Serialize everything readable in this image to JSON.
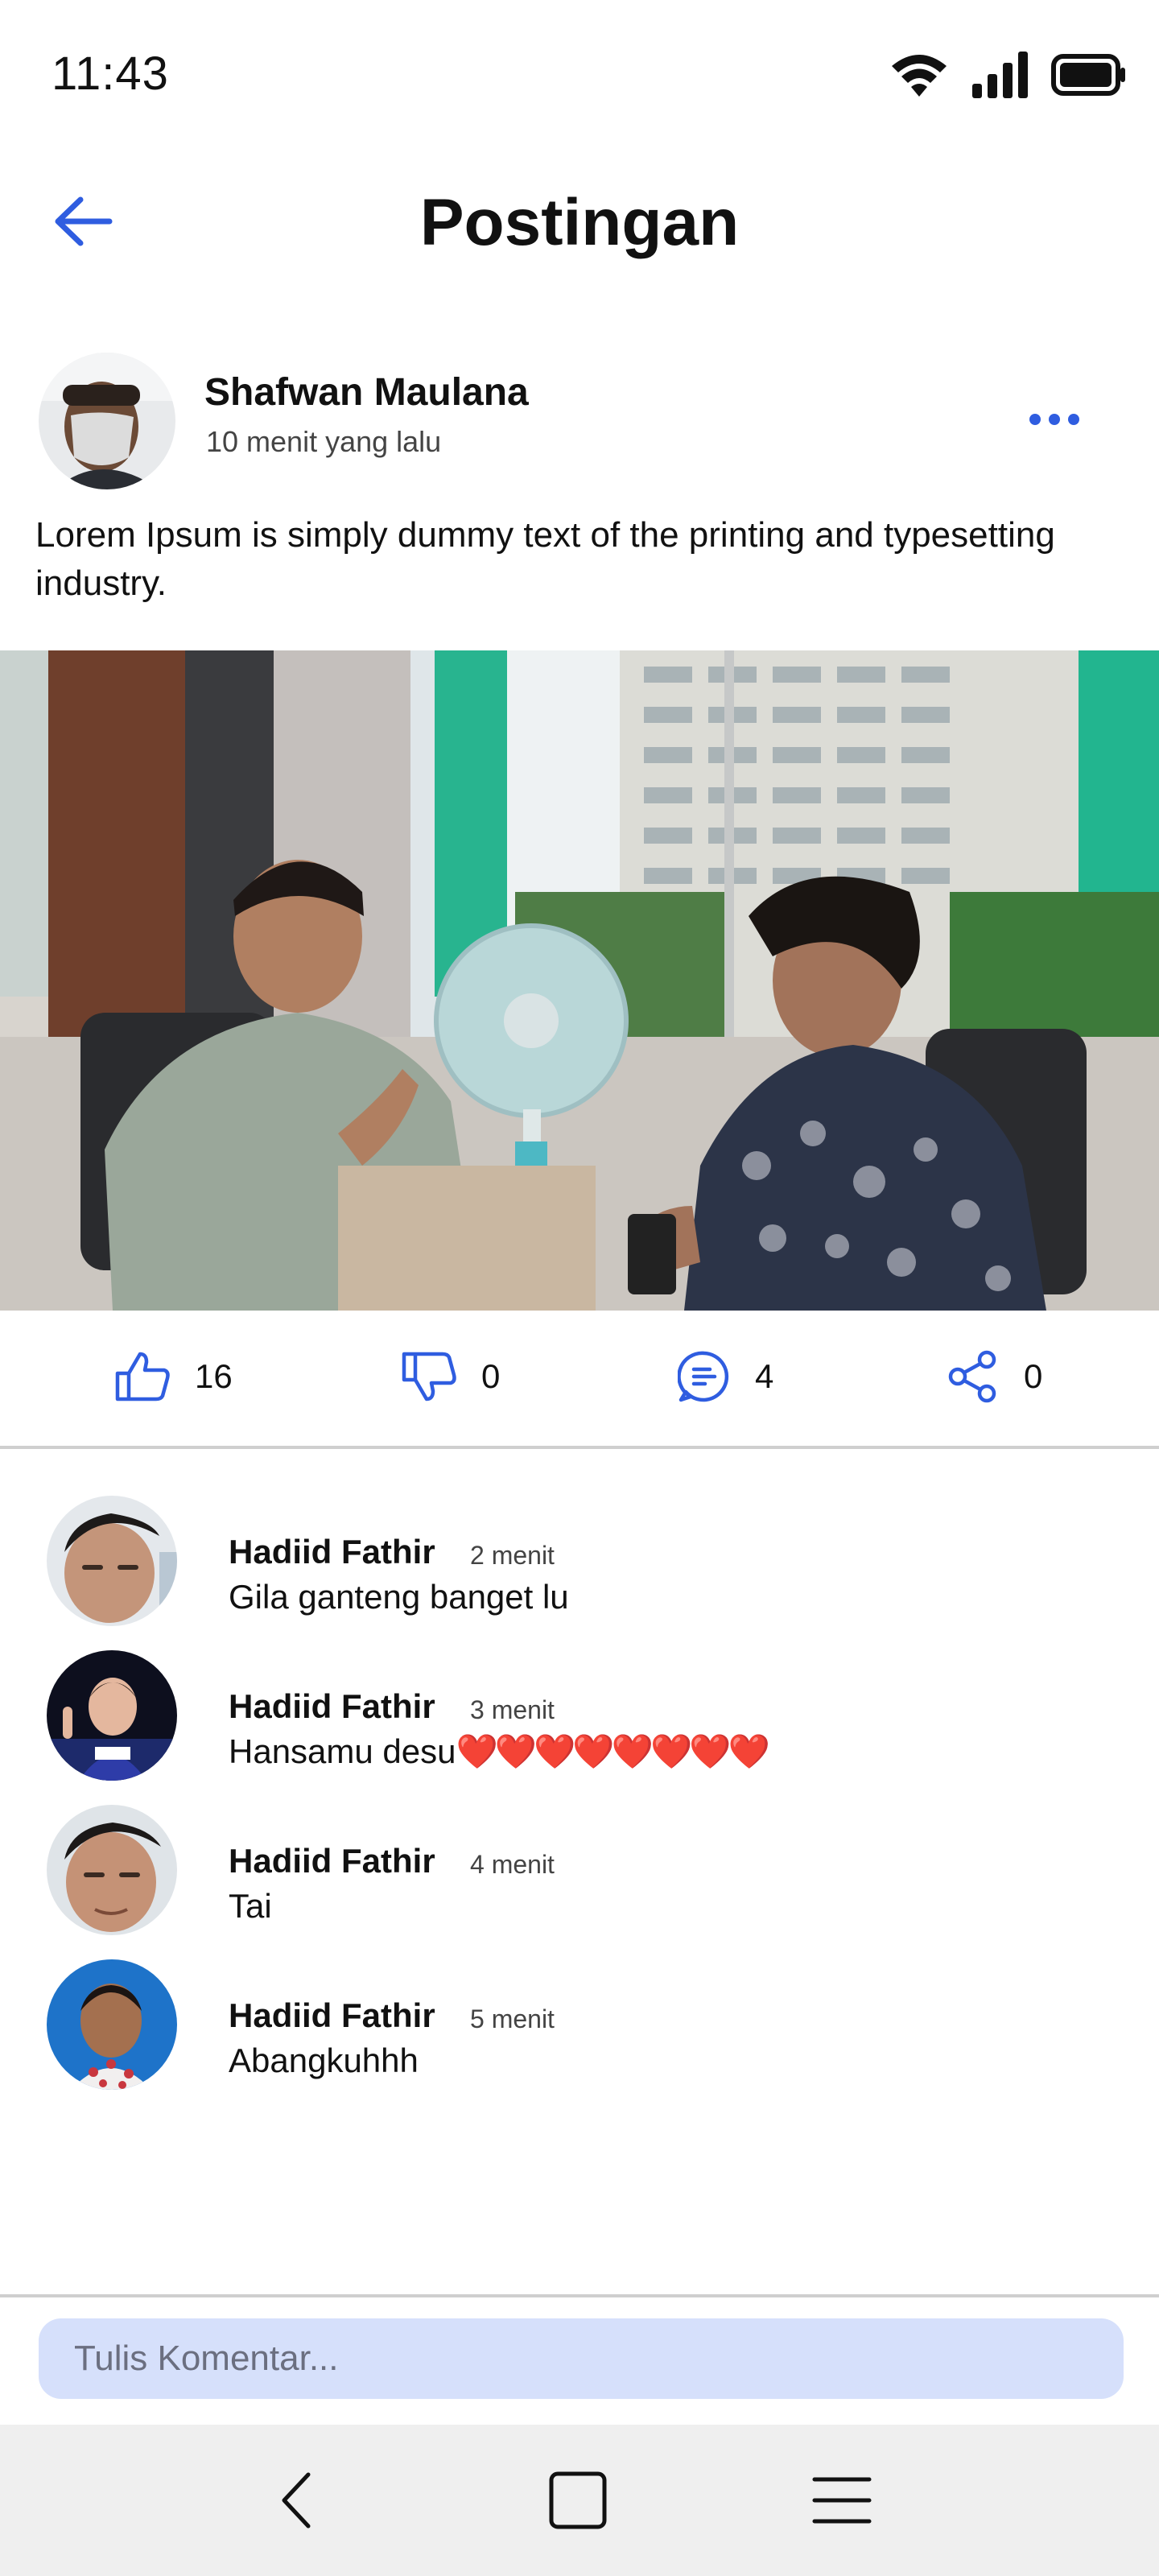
{
  "status_bar": {
    "time": "11:43",
    "icons": [
      "wifi-icon",
      "signal-icon",
      "battery-icon"
    ]
  },
  "header": {
    "title": "Postingan",
    "back_icon": "arrow-left-icon"
  },
  "post": {
    "author_name": "Shafwan Maulana",
    "time_ago": "10 menit yang lalu",
    "text": "Lorem Ipsum is simply dummy text of the printing and typesetting industry.",
    "more_icon": "more-horizontal-icon",
    "actions": {
      "likes": "16",
      "dislikes": "0",
      "comments": "4",
      "shares": "0"
    }
  },
  "comments": [
    {
      "name": "Hadiid Fathir",
      "time": "2 menit",
      "text": "Gila ganteng banget lu",
      "hearts": ""
    },
    {
      "name": "Hadiid Fathir",
      "time": "3 menit",
      "text": "Hansamu desu",
      "hearts": "❤️❤️❤️❤️❤️❤️❤️❤️"
    },
    {
      "name": "Hadiid Fathir",
      "time": "4 menit",
      "text": "Tai",
      "hearts": ""
    },
    {
      "name": "Hadiid Fathir",
      "time": "5 menit",
      "text": "Abangkuhhh",
      "hearts": ""
    }
  ],
  "comment_input": {
    "placeholder": "Tulis Komentar..."
  },
  "nav_bar": {
    "icons": [
      "back-nav-icon",
      "home-square-icon",
      "menu-icon"
    ]
  },
  "colors": {
    "accent": "#2f5de0",
    "input_bg": "#d6e0fb",
    "nav_bg": "#efefef",
    "heart": "#e31b23"
  }
}
